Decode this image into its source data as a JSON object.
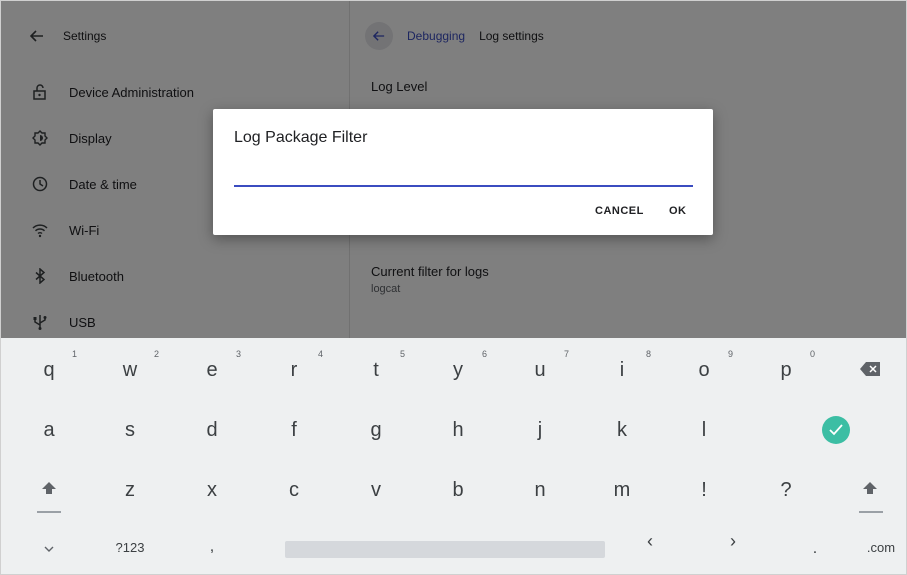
{
  "left_pane": {
    "header_title": "Settings",
    "items": [
      {
        "label": "Device Administration",
        "icon": "unlock-icon"
      },
      {
        "label": "Display",
        "icon": "brightness-icon"
      },
      {
        "label": "Date & time",
        "icon": "clock-icon"
      },
      {
        "label": "Wi-Fi",
        "icon": "wifi-icon"
      },
      {
        "label": "Bluetooth",
        "icon": "bluetooth-icon"
      },
      {
        "label": "USB",
        "icon": "usb-icon"
      }
    ]
  },
  "right_pane": {
    "breadcrumb_parent": "Debugging",
    "breadcrumb_current": "Log settings",
    "log_level_title": "Log Level",
    "current_filter_title": "Current filter for logs",
    "current_filter_value": "logcat"
  },
  "dialog": {
    "title": "Log Package Filter",
    "input_value": "",
    "cancel_label": "CANCEL",
    "ok_label": "OK"
  },
  "keyboard": {
    "row1": [
      {
        "key": "q",
        "hint": "1"
      },
      {
        "key": "w",
        "hint": "2"
      },
      {
        "key": "e",
        "hint": "3"
      },
      {
        "key": "r",
        "hint": "4"
      },
      {
        "key": "t",
        "hint": "5"
      },
      {
        "key": "y",
        "hint": "6"
      },
      {
        "key": "u",
        "hint": "7"
      },
      {
        "key": "i",
        "hint": "8"
      },
      {
        "key": "o",
        "hint": "9"
      },
      {
        "key": "p",
        "hint": "0"
      }
    ],
    "row2": [
      "a",
      "s",
      "d",
      "f",
      "g",
      "h",
      "j",
      "k",
      "l"
    ],
    "row3": [
      "z",
      "x",
      "c",
      "v",
      "b",
      "n",
      "m",
      "!",
      "?"
    ],
    "symbols_label": "?123",
    "comma": ",",
    "left_arrow": "‹",
    "right_arrow": "›",
    "period": ".",
    "com_label": ".com",
    "accent_color": "#3cbea4"
  }
}
